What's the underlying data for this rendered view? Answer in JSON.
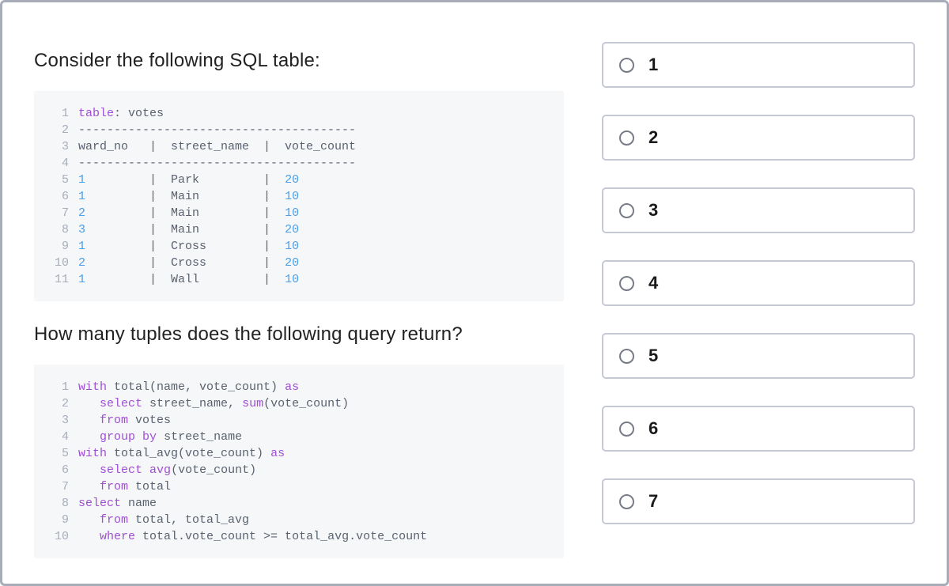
{
  "question": {
    "part1": "Consider the following SQL table:",
    "part2": "How many tuples does the following query return?"
  },
  "code1": {
    "lines": [
      [
        {
          "t": "table",
          "c": "tok-kw"
        },
        {
          "t": ": votes",
          "c": "tok-text"
        }
      ],
      [
        {
          "t": "---------------------------------------",
          "c": "tok-dash"
        }
      ],
      [
        {
          "t": "ward_no   |  street_name  |  vote_count",
          "c": "tok-text"
        }
      ],
      [
        {
          "t": "---------------------------------------",
          "c": "tok-dash"
        }
      ],
      [
        {
          "t": "1",
          "c": "tok-num"
        },
        {
          "t": "         |  Park         |  ",
          "c": "tok-text"
        },
        {
          "t": "20",
          "c": "tok-num"
        }
      ],
      [
        {
          "t": "1",
          "c": "tok-num"
        },
        {
          "t": "         |  Main         |  ",
          "c": "tok-text"
        },
        {
          "t": "10",
          "c": "tok-num"
        }
      ],
      [
        {
          "t": "2",
          "c": "tok-num"
        },
        {
          "t": "         |  Main         |  ",
          "c": "tok-text"
        },
        {
          "t": "10",
          "c": "tok-num"
        }
      ],
      [
        {
          "t": "3",
          "c": "tok-num"
        },
        {
          "t": "         |  Main         |  ",
          "c": "tok-text"
        },
        {
          "t": "20",
          "c": "tok-num"
        }
      ],
      [
        {
          "t": "1",
          "c": "tok-num"
        },
        {
          "t": "         |  Cross        |  ",
          "c": "tok-text"
        },
        {
          "t": "10",
          "c": "tok-num"
        }
      ],
      [
        {
          "t": "2",
          "c": "tok-num"
        },
        {
          "t": "         |  Cross        |  ",
          "c": "tok-text"
        },
        {
          "t": "20",
          "c": "tok-num"
        }
      ],
      [
        {
          "t": "1",
          "c": "tok-num"
        },
        {
          "t": "         |  Wall         |  ",
          "c": "tok-text"
        },
        {
          "t": "10",
          "c": "tok-num"
        }
      ]
    ]
  },
  "code2": {
    "lines": [
      [
        {
          "t": "with",
          "c": "tok-kw"
        },
        {
          "t": " total(name, vote_count) ",
          "c": "tok-text"
        },
        {
          "t": "as",
          "c": "tok-kw"
        }
      ],
      [
        {
          "t": "   ",
          "c": "tok-text"
        },
        {
          "t": "select",
          "c": "tok-kw"
        },
        {
          "t": " street_name, ",
          "c": "tok-text"
        },
        {
          "t": "sum",
          "c": "tok-kw"
        },
        {
          "t": "(vote_count)",
          "c": "tok-text"
        }
      ],
      [
        {
          "t": "   ",
          "c": "tok-text"
        },
        {
          "t": "from",
          "c": "tok-kw"
        },
        {
          "t": " votes",
          "c": "tok-text"
        }
      ],
      [
        {
          "t": "   ",
          "c": "tok-text"
        },
        {
          "t": "group",
          "c": "tok-kw"
        },
        {
          "t": " ",
          "c": "tok-text"
        },
        {
          "t": "by",
          "c": "tok-kw"
        },
        {
          "t": " street_name",
          "c": "tok-text"
        }
      ],
      [
        {
          "t": "with",
          "c": "tok-kw"
        },
        {
          "t": " total_avg(vote_count) ",
          "c": "tok-text"
        },
        {
          "t": "as",
          "c": "tok-kw"
        }
      ],
      [
        {
          "t": "   ",
          "c": "tok-text"
        },
        {
          "t": "select",
          "c": "tok-kw"
        },
        {
          "t": " ",
          "c": "tok-text"
        },
        {
          "t": "avg",
          "c": "tok-kw"
        },
        {
          "t": "(vote_count)",
          "c": "tok-text"
        }
      ],
      [
        {
          "t": "   ",
          "c": "tok-text"
        },
        {
          "t": "from",
          "c": "tok-kw"
        },
        {
          "t": " total",
          "c": "tok-text"
        }
      ],
      [
        {
          "t": "select",
          "c": "tok-kw"
        },
        {
          "t": " name",
          "c": "tok-text"
        }
      ],
      [
        {
          "t": "   ",
          "c": "tok-text"
        },
        {
          "t": "from",
          "c": "tok-kw"
        },
        {
          "t": " total, total_avg",
          "c": "tok-text"
        }
      ],
      [
        {
          "t": "   ",
          "c": "tok-text"
        },
        {
          "t": "where",
          "c": "tok-kw"
        },
        {
          "t": " total.vote_count >= total_avg.vote_count",
          "c": "tok-text"
        }
      ]
    ]
  },
  "options": [
    {
      "label": "1"
    },
    {
      "label": "2"
    },
    {
      "label": "3"
    },
    {
      "label": "4"
    },
    {
      "label": "5"
    },
    {
      "label": "6"
    },
    {
      "label": "7"
    }
  ]
}
